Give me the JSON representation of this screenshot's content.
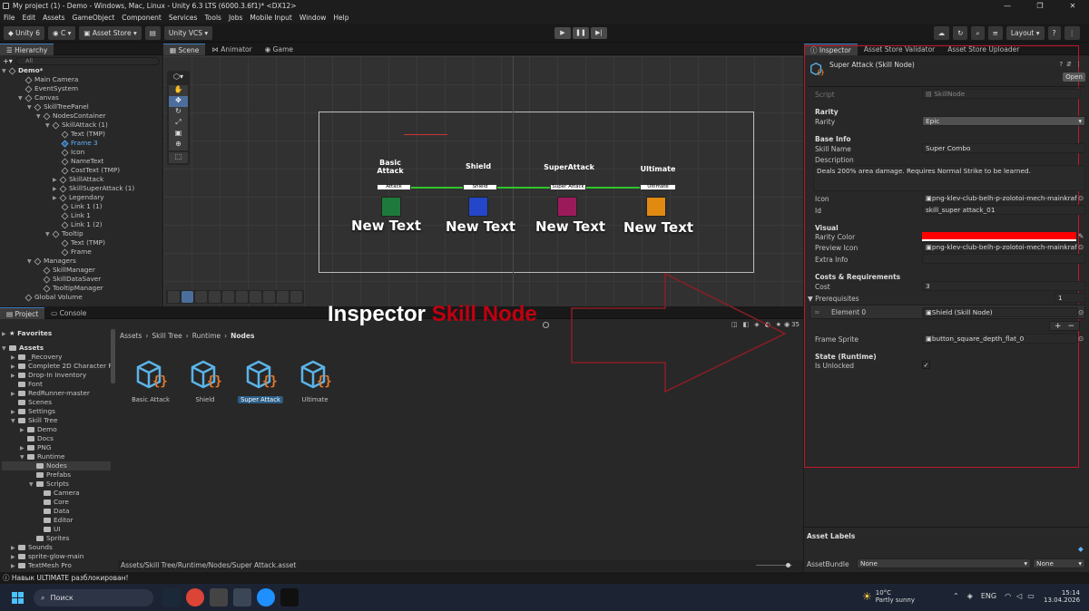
{
  "window": {
    "title": "My project (1) - Demo - Windows, Mac, Linux - Unity 6.3 LTS (6000.3.6f1)* <DX12>",
    "controls": [
      "—",
      "❐",
      "✕"
    ]
  },
  "menu": [
    "File",
    "Edit",
    "Assets",
    "GameObject",
    "Component",
    "Services",
    "Tools",
    "Jobs",
    "Mobile Input",
    "Window",
    "Help"
  ],
  "toolbar": {
    "unity_label": "Unity 6",
    "account": "C",
    "asset_store": "Asset Store",
    "vcs": "Unity VCS",
    "layout": "Layout"
  },
  "hierarchy": {
    "tab": "Hierarchy",
    "search_placeholder": "All",
    "scene": "Demo*",
    "items": [
      "Main Camera",
      "EventSystem",
      "Canvas",
      "SkillTreePanel",
      "NodesContainer",
      "SkillAttack (1)",
      "Text (TMP)",
      "Frame 3",
      "Icon",
      "NameText",
      "CostText (TMP)",
      "SkillAttack",
      "SkillSuperAttack (1)",
      "Legendary",
      "Link 1 (1)",
      "Link 1",
      "Link 1 (2)",
      "Tooltip",
      "Text (TMP)",
      "Frame",
      "Managers",
      "SkillManager",
      "SkillDataSaver",
      "TooltipManager",
      "Global Volume"
    ]
  },
  "scene_tabs": [
    "Scene",
    "Animator",
    "Game"
  ],
  "scene": {
    "nodes": [
      {
        "title": "Basic\nAttack",
        "bar": "Attack",
        "caption": "New Text",
        "color": "#1e7a3c"
      },
      {
        "title": "Shield",
        "bar": "Shield",
        "caption": "New Text",
        "color": "#2446c8"
      },
      {
        "title": "SuperAttack",
        "bar": "Super Attack",
        "caption": "New Text",
        "color": "#9b1b5a"
      },
      {
        "title": "Ultimate",
        "bar": "Ultimate",
        "caption": "New Text",
        "color": "#e08a12"
      }
    ]
  },
  "overlay": {
    "white": "Inspector",
    "red": "Skill Node"
  },
  "project": {
    "tabs": [
      "Project",
      "Console"
    ],
    "favorites": "Favorites",
    "assets": "Assets",
    "count": "35",
    "breadcrumb": [
      "Assets",
      "Skill Tree",
      "Runtime",
      "Nodes"
    ],
    "tree": [
      "_Recovery",
      "Complete 2D Character Fr",
      "Drop-In Inventory",
      "Font",
      "RedRunner-master",
      "Scenes",
      "Settings",
      "Skill Tree",
      "Demo",
      "Docs",
      "PNG",
      "Runtime",
      "Nodes",
      "Prefabs",
      "Scripts",
      "Camera",
      "Core",
      "Data",
      "Editor",
      "UI",
      "Sprites",
      "Sounds",
      "sprite-glow-main",
      "TextMesh Pro"
    ],
    "files": [
      "Basic Attack",
      "Shield",
      "Super Attack",
      "Ultimate"
    ],
    "status_path": "Assets/Skill Tree/Runtime/Nodes/Super Attack.asset"
  },
  "inspector": {
    "tabs": [
      "Inspector",
      "Asset Store Validator",
      "Asset Store Uploader"
    ],
    "title": "Super Attack (Skill Node)",
    "open": "Open",
    "script_label": "Script",
    "script_value": "SkillNode",
    "rarity_header": "Rarity",
    "rarity_label": "Rarity",
    "rarity_value": "Epic",
    "baseinfo_header": "Base Info",
    "skillname_label": "Skill Name",
    "skillname_value": "Super Combo",
    "desc_label": "Description",
    "desc_value": "Deals 200% area damage. Requires Normal Strike to be learned.",
    "icon_label": "Icon",
    "icon_value": "png-klev-club-belh-p-zolotoi-mech-mainkraf",
    "id_label": "Id",
    "id_value": "skill_super attack_01",
    "visual_header": "Visual",
    "raritycolor_label": "Rarity Color",
    "raritycolor": "#ff0000",
    "preview_label": "Preview Icon",
    "preview_value": "png-klev-club-belh-p-zolotoi-mech-mainkraf",
    "extra_label": "Extra Info",
    "cost_header": "Costs & Requirements",
    "cost_label": "Cost",
    "cost_value": "3",
    "prereq_label": "Prerequisites",
    "prereq_count": "1",
    "element_label": "Element 0",
    "element_value": "Shield (Skill Node)",
    "frame_label": "Frame Sprite",
    "frame_value": "button_square_depth_flat_0",
    "state_header": "State (Runtime)",
    "unlocked_label": "Is Unlocked",
    "unlocked": "✓",
    "asset_labels": "Asset Labels",
    "assetbundle_label": "AssetBundle",
    "bundle_value": "None",
    "variant_value": "None"
  },
  "statusbar": {
    "message": "Навык ULTIMATE разблокирован!"
  },
  "taskbar": {
    "search": "Поиск",
    "weather_temp": "10°C",
    "weather_desc": "Partly sunny",
    "lang": "ENG",
    "time": "15:14",
    "date": "13.04.2026"
  }
}
